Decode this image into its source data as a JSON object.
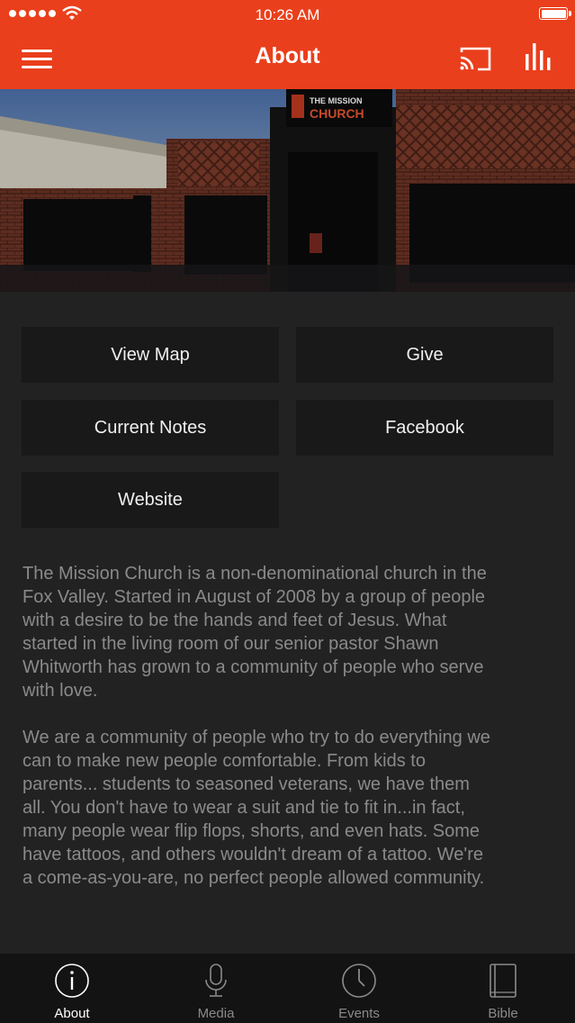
{
  "status_bar": {
    "time": "10:26 AM"
  },
  "header": {
    "title": "About"
  },
  "actions": [
    {
      "label": "View Map"
    },
    {
      "label": "Give"
    },
    {
      "label": "Current Notes"
    },
    {
      "label": "Facebook"
    },
    {
      "label": "Website"
    }
  ],
  "description": {
    "p1_lines": [
      "The Mission Church is a non-denominational church in the",
      "Fox Valley. Started in August of 2008 by a group of people",
      "with a desire to be the hands and feet of Jesus. What",
      "started in the living room of our senior pastor Shawn",
      "Whitworth has grown to a community of people who serve",
      "with love."
    ],
    "p2_lines": [
      "We are a community of people who try to do everything we",
      "can to make new people comfortable. From kids to",
      "parents... students to seasoned veterans, we have them",
      "all. You don't have to wear a suit and tie to fit in...in fact,",
      "many people wear flip flops, shorts, and even hats. Some",
      "have tattoos, and others wouldn't dream of a tattoo. We're",
      "a come-as-you-are, no perfect people allowed community."
    ]
  },
  "hero_sign": {
    "line1": "THE MISSION",
    "line2": "CHURCH"
  },
  "tabs": [
    {
      "label": "About",
      "icon": "info-icon",
      "active": true
    },
    {
      "label": "Media",
      "icon": "microphone-icon",
      "active": false
    },
    {
      "label": "Events",
      "icon": "clock-icon",
      "active": false
    },
    {
      "label": "Bible",
      "icon": "book-icon",
      "active": false
    }
  ],
  "colors": {
    "accent": "#ea3f1c",
    "background": "#232223",
    "tile": "#1a191a",
    "tabbar": "#141314"
  }
}
